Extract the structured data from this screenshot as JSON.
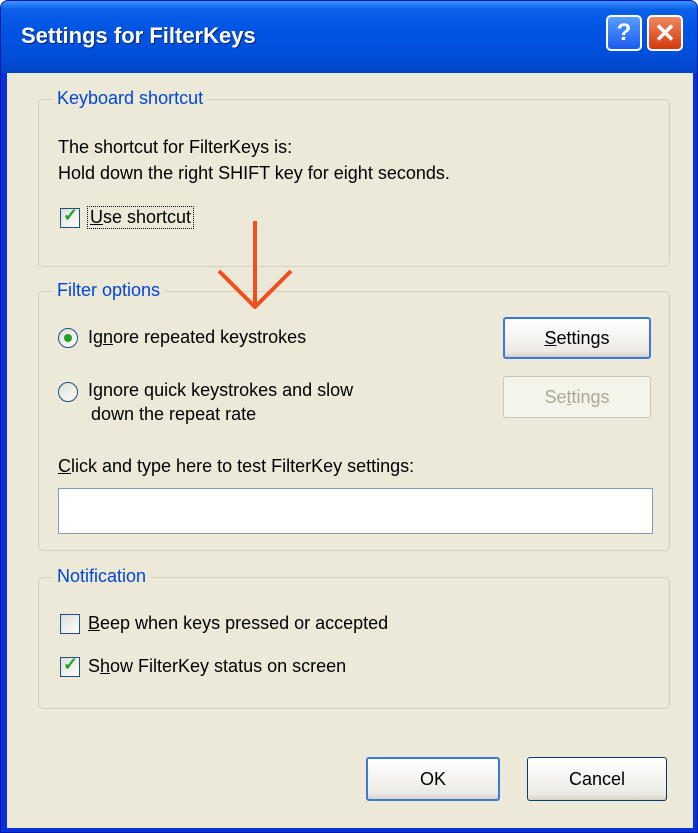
{
  "window": {
    "title": "Settings for FilterKeys"
  },
  "keyboard_shortcut": {
    "label": "Keyboard shortcut",
    "line1": "The shortcut for FilterKeys is:",
    "line2": "Hold down the right SHIFT key for eight seconds.",
    "use_shortcut_label": "Use shortcut",
    "use_shortcut_checked": true
  },
  "filter_options": {
    "label": "Filter options",
    "option1_label": "Ignore repeated keystrokes",
    "option1_selected": true,
    "option2_line1": "Ignore quick keystrokes and slow",
    "option2_line2": "down the repeat rate",
    "option2_selected": false,
    "settings1_label": "Settings",
    "settings2_label": "Settings",
    "test_label": "Click and type here to test FilterKey settings:",
    "test_value": ""
  },
  "notification": {
    "label": "Notification",
    "beep_label": "Beep when keys pressed or accepted",
    "beep_checked": false,
    "status_label": "Show FilterKey status on screen",
    "status_checked": true
  },
  "buttons": {
    "ok": "OK",
    "cancel": "Cancel"
  },
  "colors": {
    "arrow": "#f05020",
    "titlebar": "#0054e3",
    "group_label": "#0046d5",
    "check": "#21a121"
  }
}
